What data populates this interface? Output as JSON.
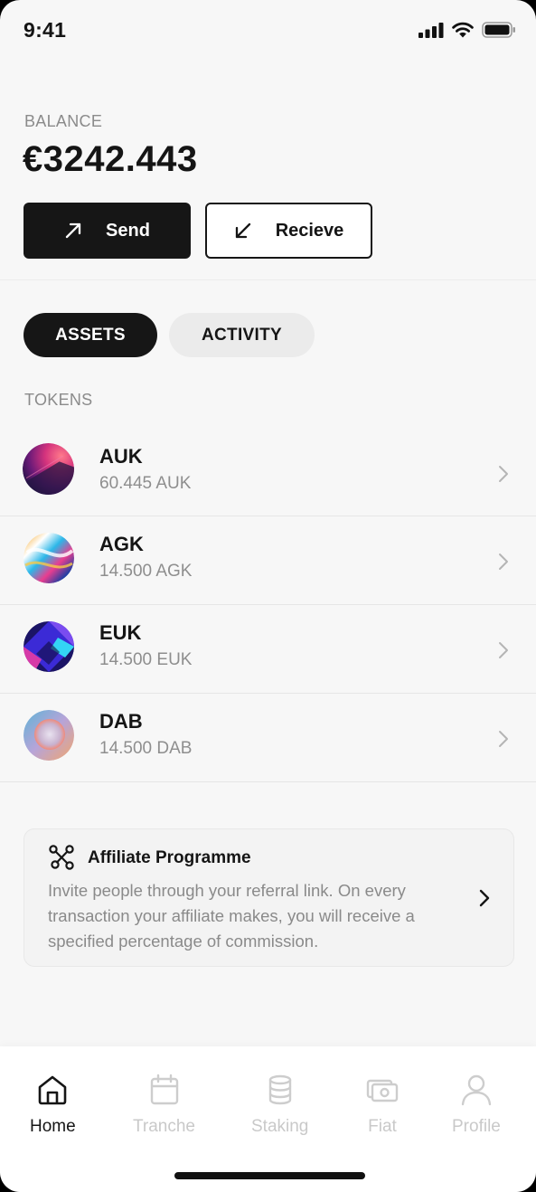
{
  "status": {
    "time": "9:41"
  },
  "balance": {
    "label": "BALANCE",
    "value": "€3242.443"
  },
  "actions": {
    "send_label": "Send",
    "receive_label": "Recieve"
  },
  "tabs": [
    {
      "label": "ASSETS",
      "active": true
    },
    {
      "label": "ACTIVITY",
      "active": false
    }
  ],
  "tokens_label": "TOKENS",
  "tokens": [
    {
      "symbol": "AUK",
      "amount": "60.445 AUK"
    },
    {
      "symbol": "AGK",
      "amount": "14.500 AGK"
    },
    {
      "symbol": "EUK",
      "amount": "14.500 EUK"
    },
    {
      "symbol": "DAB",
      "amount": "14.500 DAB"
    }
  ],
  "affiliate": {
    "title": "Affiliate Programme",
    "description": "Invite people through your referral link. On every transaction your affiliate makes, you will receive a specified percentage of commission.",
    "icon": "network-icon"
  },
  "nav": [
    {
      "label": "Home",
      "icon": "home-icon",
      "active": true
    },
    {
      "label": "Tranche",
      "icon": "calendar-icon",
      "active": false
    },
    {
      "label": "Staking",
      "icon": "coins-stack-icon",
      "active": false
    },
    {
      "label": "Fiat",
      "icon": "cash-icon",
      "active": false
    },
    {
      "label": "Profile",
      "icon": "user-icon",
      "active": false
    }
  ],
  "colors": {
    "primary": "#161616",
    "muted": "#8b8b8b",
    "inactive_nav": "#c9c9c9",
    "background": "#f7f7f7"
  }
}
